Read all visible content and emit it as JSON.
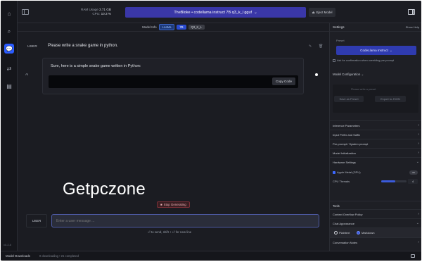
{
  "topbar": {
    "ram_label": "RAM Usage",
    "ram_value": "3.71 GB",
    "cpu_label": "CPU:",
    "cpu_value": "10.3 %",
    "model_name": "TheBloke • codellama instruct 7B q3_k_l gguf",
    "model_chevron": "⌄",
    "eject_label": "Eject Model",
    "eject_icon": "⏏"
  },
  "model_info": {
    "label": "Model Info",
    "tags": [
      "LLaMa",
      "7B",
      "Q3_K_L"
    ]
  },
  "chat": {
    "user_role": "USER",
    "user_message": "Please write a snake game in python.",
    "edit_icon": "✎",
    "delete_icon": "🗑",
    "ai_role": "AI",
    "ai_message": "Sure, here is a simple snake game written in Python:",
    "copy_label": "Copy Code",
    "watermark": "Getpczone",
    "stop_label": "Stop Generating",
    "stop_icon": "■",
    "input_role": "USER",
    "input_placeholder": "Enter a user message ...",
    "hint": "⏎ to send, shift + ⏎ for new line"
  },
  "rail": {
    "icons": [
      "home-icon",
      "search-icon",
      "chat-icon",
      "transfer-icon",
      "folder-icon"
    ],
    "glyphs": [
      "⌂",
      "⌕",
      "💬",
      "⇄",
      "▤"
    ],
    "version": "v0.2.8"
  },
  "panel": {
    "title": "Settings",
    "show_help": "Show Help",
    "preset_label": "Preset",
    "preset_value": "CodeLlama Instruct",
    "ask_label": "Ask for confirmation when overriding pre-prompt",
    "model_config": "Model Configuration",
    "cfg_preset_placeholder": "Please write a preset",
    "save_preset": "Save as Preset",
    "export_json": "Export to JSON",
    "accordions": [
      "Inference Parameters",
      "Input Prefix and Suffix",
      "Pre-prompt / System prompt",
      "Model Initialization",
      "Hardware Settings"
    ],
    "apple_metal": "Apple Metal (GPU)",
    "apple_metal_state": "on",
    "cpu_threads": "CPU Threads",
    "cpu_threads_value": "4",
    "cpu_threads_fraction": 0.55,
    "tools": "Tools",
    "context_overflow": "Context Overflow Policy",
    "chat_appearance": "Chat Appearance",
    "plaintext": "Plaintext",
    "markdown": "Markdown",
    "conversation_notes": "Conversation Notes",
    "accent": "#3b5bdc"
  },
  "status": {
    "title": "Model Downloads",
    "sub": "0 downloading • 21 completed"
  }
}
